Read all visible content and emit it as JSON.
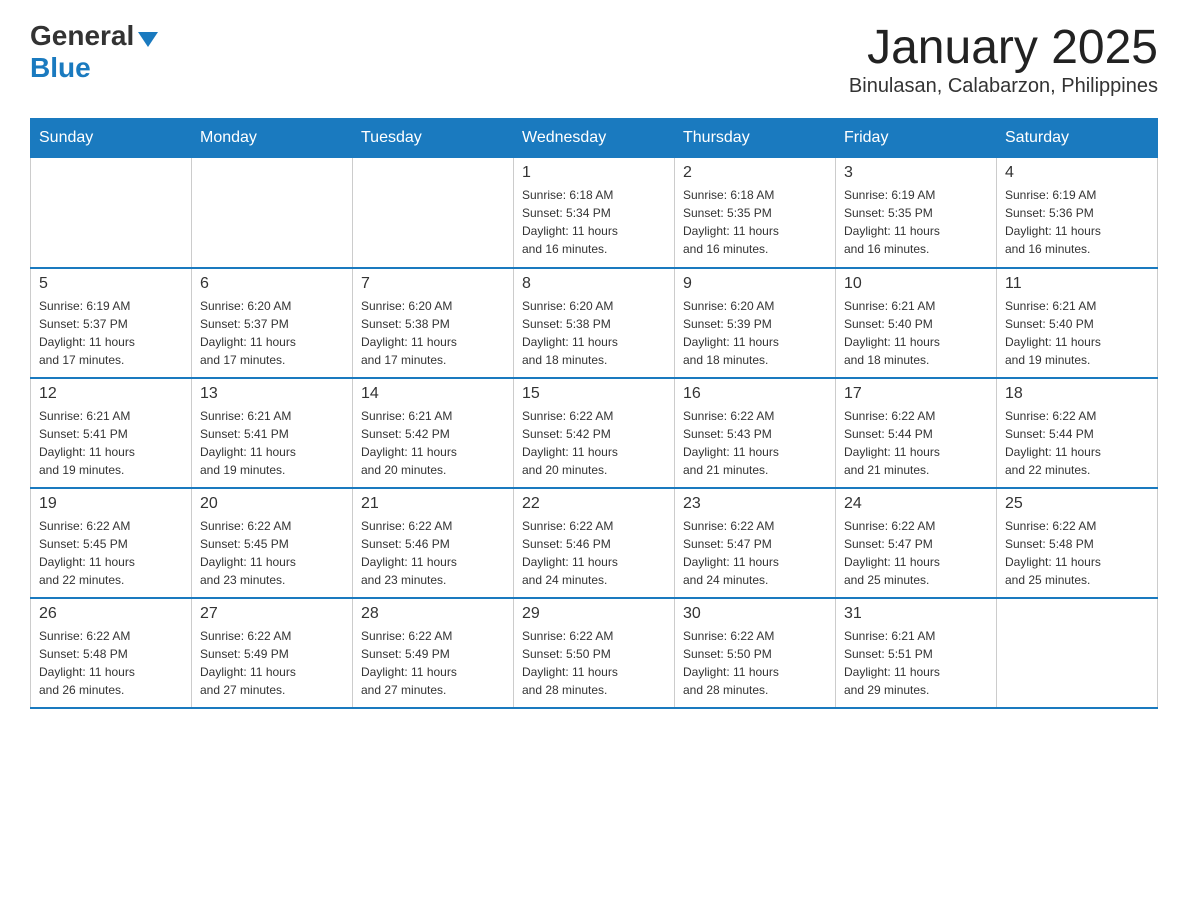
{
  "header": {
    "logo": {
      "general": "General",
      "blue": "Blue"
    },
    "title": "January 2025",
    "subtitle": "Binulasan, Calabarzon, Philippines"
  },
  "weekdays": [
    "Sunday",
    "Monday",
    "Tuesday",
    "Wednesday",
    "Thursday",
    "Friday",
    "Saturday"
  ],
  "weeks": [
    [
      {
        "day": "",
        "info": ""
      },
      {
        "day": "",
        "info": ""
      },
      {
        "day": "",
        "info": ""
      },
      {
        "day": "1",
        "info": "Sunrise: 6:18 AM\nSunset: 5:34 PM\nDaylight: 11 hours\nand 16 minutes."
      },
      {
        "day": "2",
        "info": "Sunrise: 6:18 AM\nSunset: 5:35 PM\nDaylight: 11 hours\nand 16 minutes."
      },
      {
        "day": "3",
        "info": "Sunrise: 6:19 AM\nSunset: 5:35 PM\nDaylight: 11 hours\nand 16 minutes."
      },
      {
        "day": "4",
        "info": "Sunrise: 6:19 AM\nSunset: 5:36 PM\nDaylight: 11 hours\nand 16 minutes."
      }
    ],
    [
      {
        "day": "5",
        "info": "Sunrise: 6:19 AM\nSunset: 5:37 PM\nDaylight: 11 hours\nand 17 minutes."
      },
      {
        "day": "6",
        "info": "Sunrise: 6:20 AM\nSunset: 5:37 PM\nDaylight: 11 hours\nand 17 minutes."
      },
      {
        "day": "7",
        "info": "Sunrise: 6:20 AM\nSunset: 5:38 PM\nDaylight: 11 hours\nand 17 minutes."
      },
      {
        "day": "8",
        "info": "Sunrise: 6:20 AM\nSunset: 5:38 PM\nDaylight: 11 hours\nand 18 minutes."
      },
      {
        "day": "9",
        "info": "Sunrise: 6:20 AM\nSunset: 5:39 PM\nDaylight: 11 hours\nand 18 minutes."
      },
      {
        "day": "10",
        "info": "Sunrise: 6:21 AM\nSunset: 5:40 PM\nDaylight: 11 hours\nand 18 minutes."
      },
      {
        "day": "11",
        "info": "Sunrise: 6:21 AM\nSunset: 5:40 PM\nDaylight: 11 hours\nand 19 minutes."
      }
    ],
    [
      {
        "day": "12",
        "info": "Sunrise: 6:21 AM\nSunset: 5:41 PM\nDaylight: 11 hours\nand 19 minutes."
      },
      {
        "day": "13",
        "info": "Sunrise: 6:21 AM\nSunset: 5:41 PM\nDaylight: 11 hours\nand 19 minutes."
      },
      {
        "day": "14",
        "info": "Sunrise: 6:21 AM\nSunset: 5:42 PM\nDaylight: 11 hours\nand 20 minutes."
      },
      {
        "day": "15",
        "info": "Sunrise: 6:22 AM\nSunset: 5:42 PM\nDaylight: 11 hours\nand 20 minutes."
      },
      {
        "day": "16",
        "info": "Sunrise: 6:22 AM\nSunset: 5:43 PM\nDaylight: 11 hours\nand 21 minutes."
      },
      {
        "day": "17",
        "info": "Sunrise: 6:22 AM\nSunset: 5:44 PM\nDaylight: 11 hours\nand 21 minutes."
      },
      {
        "day": "18",
        "info": "Sunrise: 6:22 AM\nSunset: 5:44 PM\nDaylight: 11 hours\nand 22 minutes."
      }
    ],
    [
      {
        "day": "19",
        "info": "Sunrise: 6:22 AM\nSunset: 5:45 PM\nDaylight: 11 hours\nand 22 minutes."
      },
      {
        "day": "20",
        "info": "Sunrise: 6:22 AM\nSunset: 5:45 PM\nDaylight: 11 hours\nand 23 minutes."
      },
      {
        "day": "21",
        "info": "Sunrise: 6:22 AM\nSunset: 5:46 PM\nDaylight: 11 hours\nand 23 minutes."
      },
      {
        "day": "22",
        "info": "Sunrise: 6:22 AM\nSunset: 5:46 PM\nDaylight: 11 hours\nand 24 minutes."
      },
      {
        "day": "23",
        "info": "Sunrise: 6:22 AM\nSunset: 5:47 PM\nDaylight: 11 hours\nand 24 minutes."
      },
      {
        "day": "24",
        "info": "Sunrise: 6:22 AM\nSunset: 5:47 PM\nDaylight: 11 hours\nand 25 minutes."
      },
      {
        "day": "25",
        "info": "Sunrise: 6:22 AM\nSunset: 5:48 PM\nDaylight: 11 hours\nand 25 minutes."
      }
    ],
    [
      {
        "day": "26",
        "info": "Sunrise: 6:22 AM\nSunset: 5:48 PM\nDaylight: 11 hours\nand 26 minutes."
      },
      {
        "day": "27",
        "info": "Sunrise: 6:22 AM\nSunset: 5:49 PM\nDaylight: 11 hours\nand 27 minutes."
      },
      {
        "day": "28",
        "info": "Sunrise: 6:22 AM\nSunset: 5:49 PM\nDaylight: 11 hours\nand 27 minutes."
      },
      {
        "day": "29",
        "info": "Sunrise: 6:22 AM\nSunset: 5:50 PM\nDaylight: 11 hours\nand 28 minutes."
      },
      {
        "day": "30",
        "info": "Sunrise: 6:22 AM\nSunset: 5:50 PM\nDaylight: 11 hours\nand 28 minutes."
      },
      {
        "day": "31",
        "info": "Sunrise: 6:21 AM\nSunset: 5:51 PM\nDaylight: 11 hours\nand 29 minutes."
      },
      {
        "day": "",
        "info": ""
      }
    ]
  ]
}
